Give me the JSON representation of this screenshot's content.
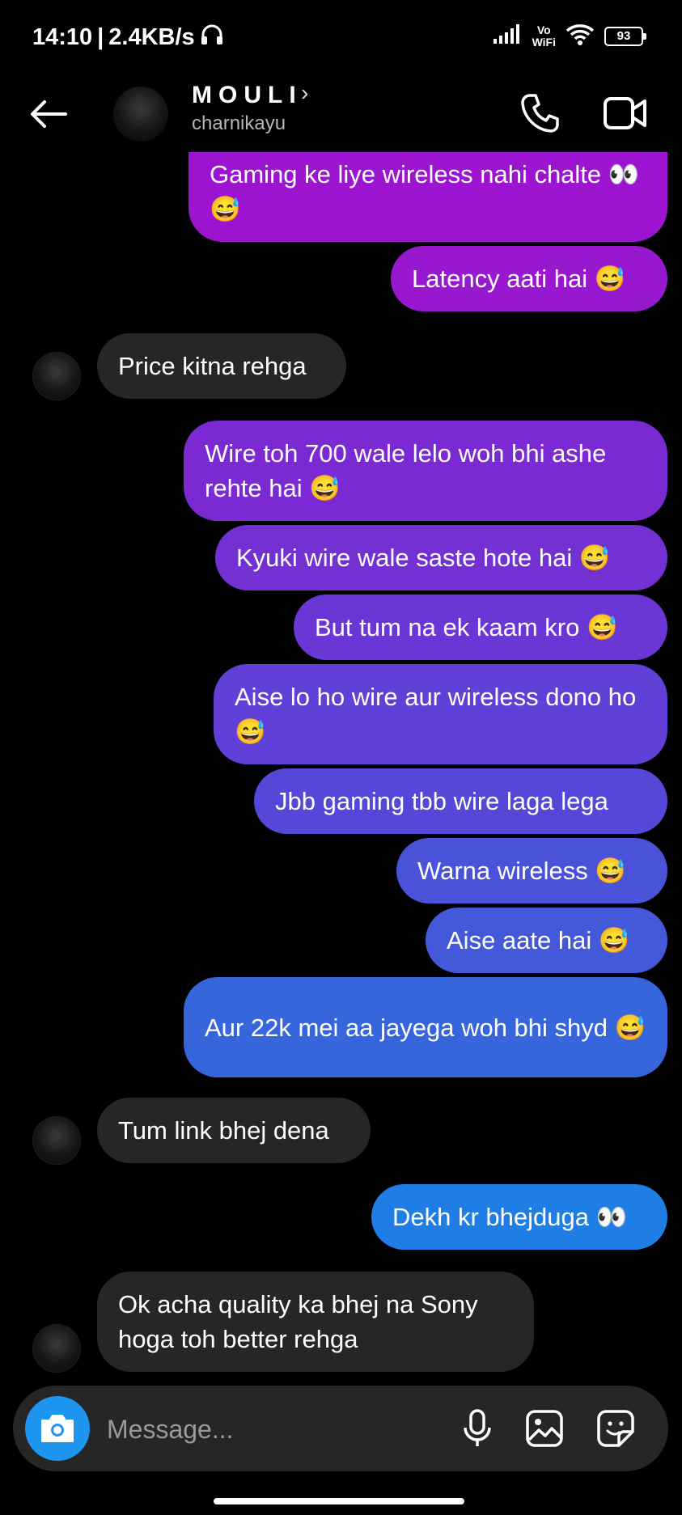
{
  "status_bar": {
    "time": "14:10",
    "speed": "2.4KB/s",
    "volte_line1": "Vo",
    "volte_line2": "WiFi",
    "battery": "93"
  },
  "header": {
    "name": "MOULI",
    "username": "charnikayu"
  },
  "messages": [
    {
      "side": "sent",
      "text": "Gaming ke liye wireless nahi chalte 👀😅",
      "color": "#9c14cf"
    },
    {
      "side": "sent",
      "text": "Latency aati hai 😅",
      "color": "#9818cf"
    },
    {
      "side": "received",
      "text": "Price kitna rehga"
    },
    {
      "side": "sent",
      "text": "Wire toh 700 wale lelo woh bhi ashe rehte hai 😅",
      "color": "#7b2ad3"
    },
    {
      "side": "sent",
      "text": "Kyuki wire wale saste hote hai 😅",
      "color": "#7330d3"
    },
    {
      "side": "sent",
      "text": "But tum na ek kaam kro 😅",
      "color": "#6b36d6"
    },
    {
      "side": "sent",
      "text": "Aise lo ho wire aur wireless dono ho 😅",
      "color": "#6040d6"
    },
    {
      "side": "sent",
      "text": "Jbb gaming tbb wire laga lega",
      "color": "#5548d8"
    },
    {
      "side": "sent",
      "text": "Warna wireless 😅",
      "color": "#4a52d9"
    },
    {
      "side": "sent",
      "text": "Aise aate hai 😅",
      "color": "#4458da"
    },
    {
      "side": "sent",
      "text": "Aur 22k mei aa jayega woh bhi shyd 😅",
      "color": "#3766dc"
    },
    {
      "side": "received",
      "text": "Tum link bhej dena"
    },
    {
      "side": "sent",
      "text": "Dekh kr bhejduga 👀",
      "color": "#1f7ee6"
    },
    {
      "side": "received",
      "text": "Ok acha quality ka bhej na Sony hoga toh better rehga"
    }
  ],
  "composer": {
    "placeholder": "Message..."
  },
  "colors": {
    "received_bubble": "#262626",
    "camera_button": "#1e96f0"
  }
}
